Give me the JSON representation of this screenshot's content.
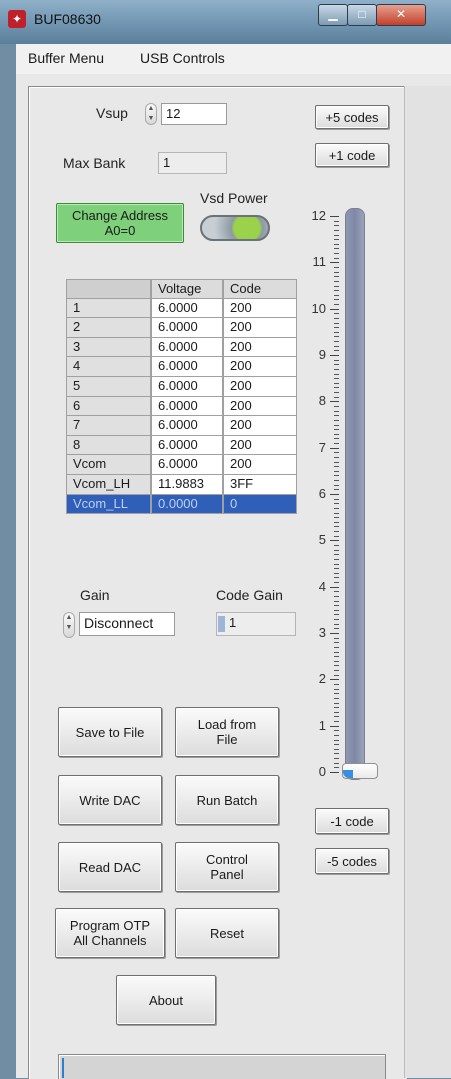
{
  "window": {
    "title": "BUF08630",
    "icon": "ti-logo-icon"
  },
  "menu": {
    "items": [
      "Buffer Menu",
      "USB Controls"
    ]
  },
  "vsup": {
    "label": "Vsup",
    "value": "12"
  },
  "max_bank": {
    "label": "Max Bank",
    "value": "1"
  },
  "change_address": {
    "line1": "Change Address",
    "line2": "A0=0"
  },
  "vsd_power": {
    "label": "Vsd Power",
    "state": "on"
  },
  "table": {
    "headers": [
      "",
      "Voltage",
      "Code"
    ],
    "rows": [
      [
        "1",
        "6.0000",
        "200"
      ],
      [
        "2",
        "6.0000",
        "200"
      ],
      [
        "3",
        "6.0000",
        "200"
      ],
      [
        "4",
        "6.0000",
        "200"
      ],
      [
        "5",
        "6.0000",
        "200"
      ],
      [
        "6",
        "6.0000",
        "200"
      ],
      [
        "7",
        "6.0000",
        "200"
      ],
      [
        "8",
        "6.0000",
        "200"
      ],
      [
        "Vcom",
        "6.0000",
        "200"
      ],
      [
        "Vcom_LH",
        "11.9883",
        "3FF"
      ],
      [
        "Vcom_LL",
        "0.0000",
        "0"
      ]
    ],
    "selected_row": 10
  },
  "gain": {
    "label": "Gain",
    "value": "Disconnect"
  },
  "code_gain": {
    "label": "Code Gain",
    "value": "1"
  },
  "buttons": {
    "save_to_file": "Save to File",
    "load_from_file_l1": "Load from",
    "load_from_file_l2": "File",
    "write_dac": "Write DAC",
    "run_batch": "Run Batch",
    "read_dac": "Read DAC",
    "control_panel_l1": "Control",
    "control_panel_l2": "Panel",
    "program_otp_l1": "Program OTP",
    "program_otp_l2": "All Channels",
    "reset": "Reset",
    "about": "About"
  },
  "code_buttons": {
    "plus5": "+5 codes",
    "plus1": "+1 code",
    "minus1": "-1 code",
    "minus5": "-5 codes"
  },
  "slider": {
    "min": 0,
    "max": 12,
    "value": 0,
    "tick_labels": [
      "12",
      "11",
      "10",
      "9",
      "8",
      "7",
      "6",
      "5",
      "4",
      "3",
      "2",
      "1",
      "0"
    ]
  }
}
